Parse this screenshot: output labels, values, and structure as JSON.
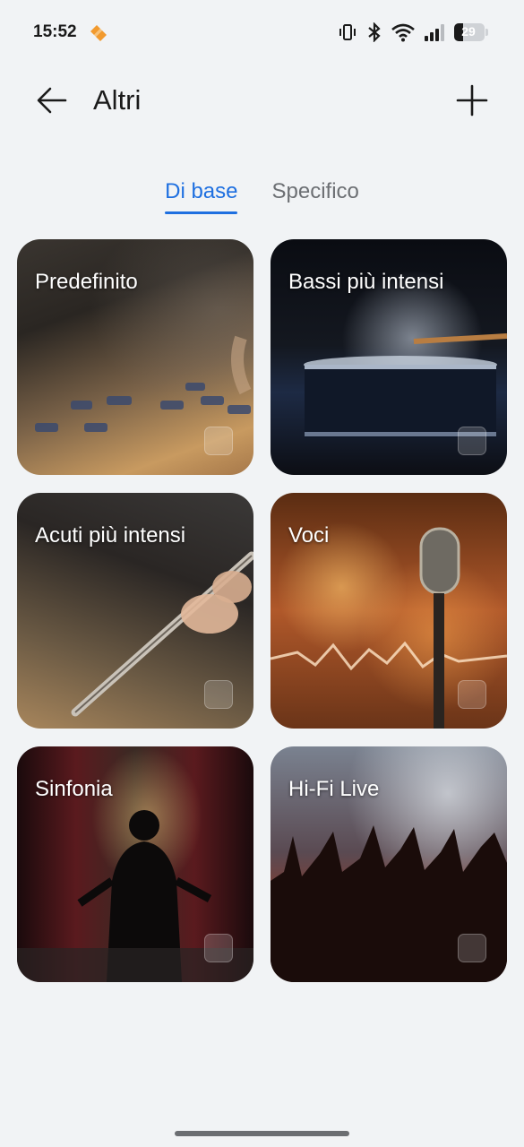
{
  "status_bar": {
    "time": "15:52",
    "battery_level": "29",
    "battery_fraction": 0.29,
    "icons": [
      "app-notification-icon",
      "vibrate-icon",
      "bluetooth-icon",
      "wifi-icon",
      "signal-icon",
      "battery-icon"
    ]
  },
  "header": {
    "title": "Altri",
    "back_icon": "arrow-left-icon",
    "add_icon": "plus-icon"
  },
  "tabs": [
    {
      "label": "Di base",
      "active": true
    },
    {
      "label": "Specifico",
      "active": false
    }
  ],
  "presets": [
    {
      "label": "Predefinito"
    },
    {
      "label": "Bassi più intensi"
    },
    {
      "label": "Acuti più intensi"
    },
    {
      "label": "Voci"
    },
    {
      "label": "Sinfonia"
    },
    {
      "label": "Hi-Fi Live"
    }
  ],
  "colors": {
    "accent": "#1e6fe0",
    "background": "#f1f3f5",
    "text": "#1a1a1a",
    "inactive_tab": "#6c6f73"
  }
}
